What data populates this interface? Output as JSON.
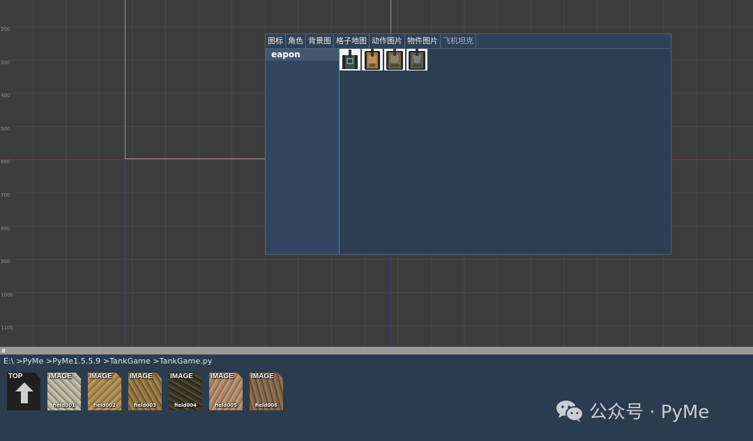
{
  "canvas": {
    "ruler_labels": [
      "200",
      "300",
      "400",
      "500",
      "600",
      "700",
      "800",
      "900",
      "1000",
      "1100"
    ]
  },
  "asset_panel": {
    "tabs": [
      {
        "label": "图标"
      },
      {
        "label": "角色"
      },
      {
        "label": "背景图"
      },
      {
        "label": "格子地图"
      },
      {
        "label": "动作图片"
      },
      {
        "label": "物件图片"
      },
      {
        "label": "飞机坦克"
      }
    ],
    "categories": [
      {
        "label": "eapon"
      }
    ],
    "sprites": [
      {
        "icon": "green-tank-icon"
      },
      {
        "icon": "tan-tank-icon"
      },
      {
        "icon": "olive-tank-icon"
      },
      {
        "icon": "gray-tank-icon"
      }
    ]
  },
  "browser": {
    "breadcrumb": "E:\\ >PyMe >PyMe1.5.5.9 >TankGame >TankGame.py",
    "top_label": "TOP",
    "items": [
      {
        "badge": "IMAGE",
        "name": "field001",
        "color": "#b3ac9a"
      },
      {
        "badge": "IMAGE",
        "name": "field002",
        "color": "#a88755"
      },
      {
        "badge": "IMAGE",
        "name": "field003",
        "color": "#8c7040"
      },
      {
        "badge": "IMAGE",
        "name": "field004",
        "color": "#3a3426"
      },
      {
        "badge": "IMAGE",
        "name": "field005",
        "color": "#a98565"
      },
      {
        "badge": "IMAGE",
        "name": "field006",
        "color": "#7e6348"
      }
    ]
  },
  "watermark": {
    "text": "公众号 · PyMe"
  }
}
